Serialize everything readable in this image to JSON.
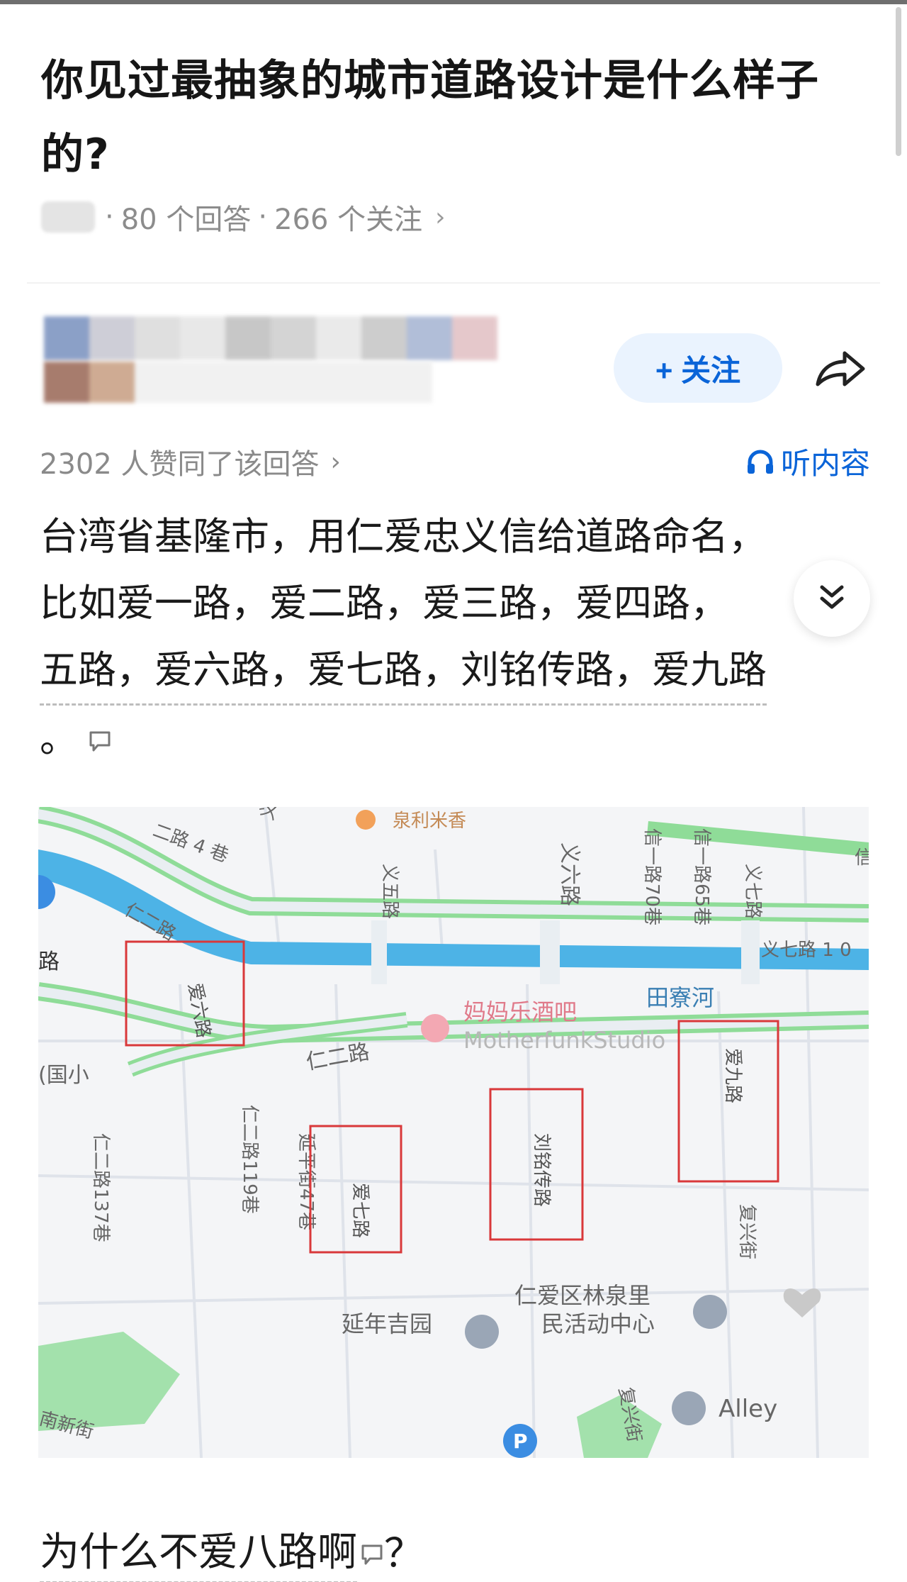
{
  "question": {
    "title": "你见过最抽象的城市道路设计是什么样子的?",
    "answers_count": "80 个回答",
    "separator": "·",
    "followers_count": "266 个关注",
    "chevron": "›"
  },
  "author": {
    "follow_label": "+ 关注",
    "share_icon": "share-icon"
  },
  "answer": {
    "votes": "2302 人赞同了该回答",
    "chevron": "›",
    "listen_label": "听内容",
    "listen_icon": "headphones-icon",
    "lines": [
      "台湾省基隆市，用仁爱忠义信给道路命名，",
      "比如爱一路，爱二路，爱三路，爱四路，",
      "五路，爱六路，爱七路，刘铭传路，爱九路",
      "。"
    ],
    "expand_icon": "double-chevron-down-icon",
    "comment_icon": "comment-icon"
  },
  "map": {
    "labels": {
      "quanli": "泉利米香",
      "lu4xiang": "二路 4 巷",
      "yisi": "义四路",
      "yiwu": "义五路",
      "yiliu": "义六路",
      "xinyi70": "信一路70巷",
      "xinyi65": "信一路65巷",
      "yiqi": "义七路",
      "yiqi_right": "义七路 1 0",
      "xin_right": "信",
      "tianliao": "田寮河",
      "renerlu_left": "仁二路",
      "lu_left": "路",
      "ailiu": "爱六路",
      "bar": "妈妈乐酒吧",
      "bar_en": "MotherfunkStudio",
      "guoxiao": "(国小",
      "renerlu_mid": "仁二路",
      "aijiu": "爱九路",
      "rener119": "仁二路119巷",
      "rener137": "仁二路137巷",
      "yanping47": "延平街47巷",
      "aiqi": "爱七路",
      "liumingchuan": "刘铭传路",
      "fuxing": "复兴街",
      "linquan1": "仁爱区林泉里",
      "linquan2": "民活动中心",
      "yannian": "延年吉园",
      "alley": "Alley",
      "nanxin": "南新街",
      "fuxing_bottom": "复兴街",
      "parking": "P"
    },
    "highlight_color": "#d9383a",
    "like_icon": "heart-icon"
  },
  "follow_up": {
    "text": "为什么不爱八路啊",
    "suffix": "？"
  },
  "colors": {
    "accent": "#0a64d8",
    "river": "#4db3e6",
    "road_green": "#6fd07c"
  }
}
